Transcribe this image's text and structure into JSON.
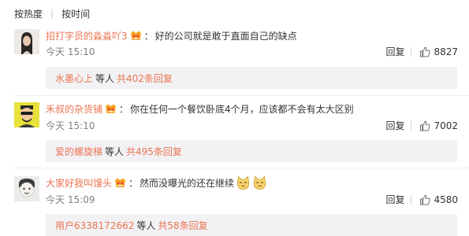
{
  "sort_tabs": [
    "按热度",
    "按时间"
  ],
  "comments": [
    {
      "username": "招打字员的淼淼吖3",
      "colon": "：",
      "text": "好的公司就是敢于直面自己的缺点",
      "time": "今天 15:10",
      "reply_label": "回复",
      "likes": "8827",
      "reply_user": "水墨心上",
      "reply_mid": "等人",
      "reply_count": "共402条回复"
    },
    {
      "username": "禾叔的杂货铺",
      "colon": "：",
      "text": "你在任何一个餐饮卧底4个月，应该都不会有太大区别",
      "time": "今天 15:10",
      "reply_label": "回复",
      "likes": "7002",
      "reply_user": "爱的螺旋梯",
      "reply_mid": "等人",
      "reply_count": "共495条回复"
    },
    {
      "username": "大家好我叫馒头",
      "colon": "：",
      "text": "然而没曝光的还在继续",
      "time": "今天 15:09",
      "reply_label": "回复",
      "likes": "4580",
      "reply_user": "用户6338172662",
      "reply_mid": "等人",
      "reply_count": "共58条回复"
    }
  ],
  "colors": {
    "accent": "#eb7350",
    "meta": "#808080",
    "sub_bg": "#f2f2f5"
  },
  "icons": [
    "vip-badge-icon",
    "thumbs-up-icon",
    "cat-emoji-icon"
  ]
}
